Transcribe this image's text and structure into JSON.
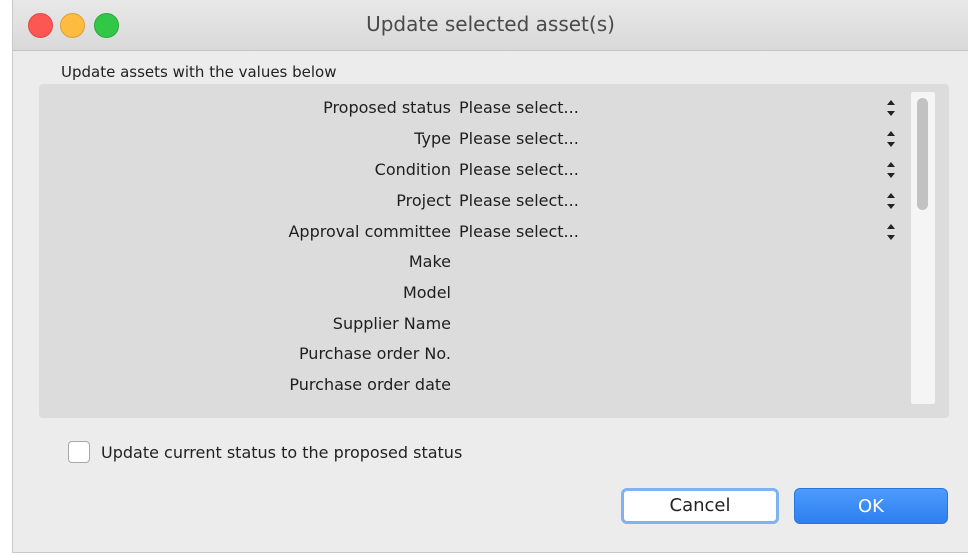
{
  "window": {
    "title": "Update selected asset(s)"
  },
  "group": {
    "caption": "Update assets with the values below"
  },
  "fields": [
    {
      "label": "Proposed status",
      "value": "Please select...",
      "has_stepper": true
    },
    {
      "label": "Type",
      "value": "Please select...",
      "has_stepper": true
    },
    {
      "label": "Condition",
      "value": "Please select...",
      "has_stepper": true
    },
    {
      "label": "Project",
      "value": "Please select...",
      "has_stepper": true
    },
    {
      "label": "Approval committee",
      "value": "Please select...",
      "has_stepper": true
    },
    {
      "label": "Make",
      "value": "",
      "has_stepper": false
    },
    {
      "label": "Model",
      "value": "",
      "has_stepper": false
    },
    {
      "label": "Supplier Name",
      "value": "",
      "has_stepper": false
    },
    {
      "label": "Purchase order No.",
      "value": "",
      "has_stepper": false
    },
    {
      "label": "Purchase order date",
      "value": "",
      "has_stepper": false
    }
  ],
  "checkbox": {
    "label": "Update current status to the proposed status",
    "checked": false
  },
  "buttons": {
    "cancel": "Cancel",
    "ok": "OK"
  },
  "colors": {
    "close": "#fc5753",
    "minimize": "#fdbc40",
    "maximize": "#33c748",
    "accent": "#2e7ff0"
  }
}
